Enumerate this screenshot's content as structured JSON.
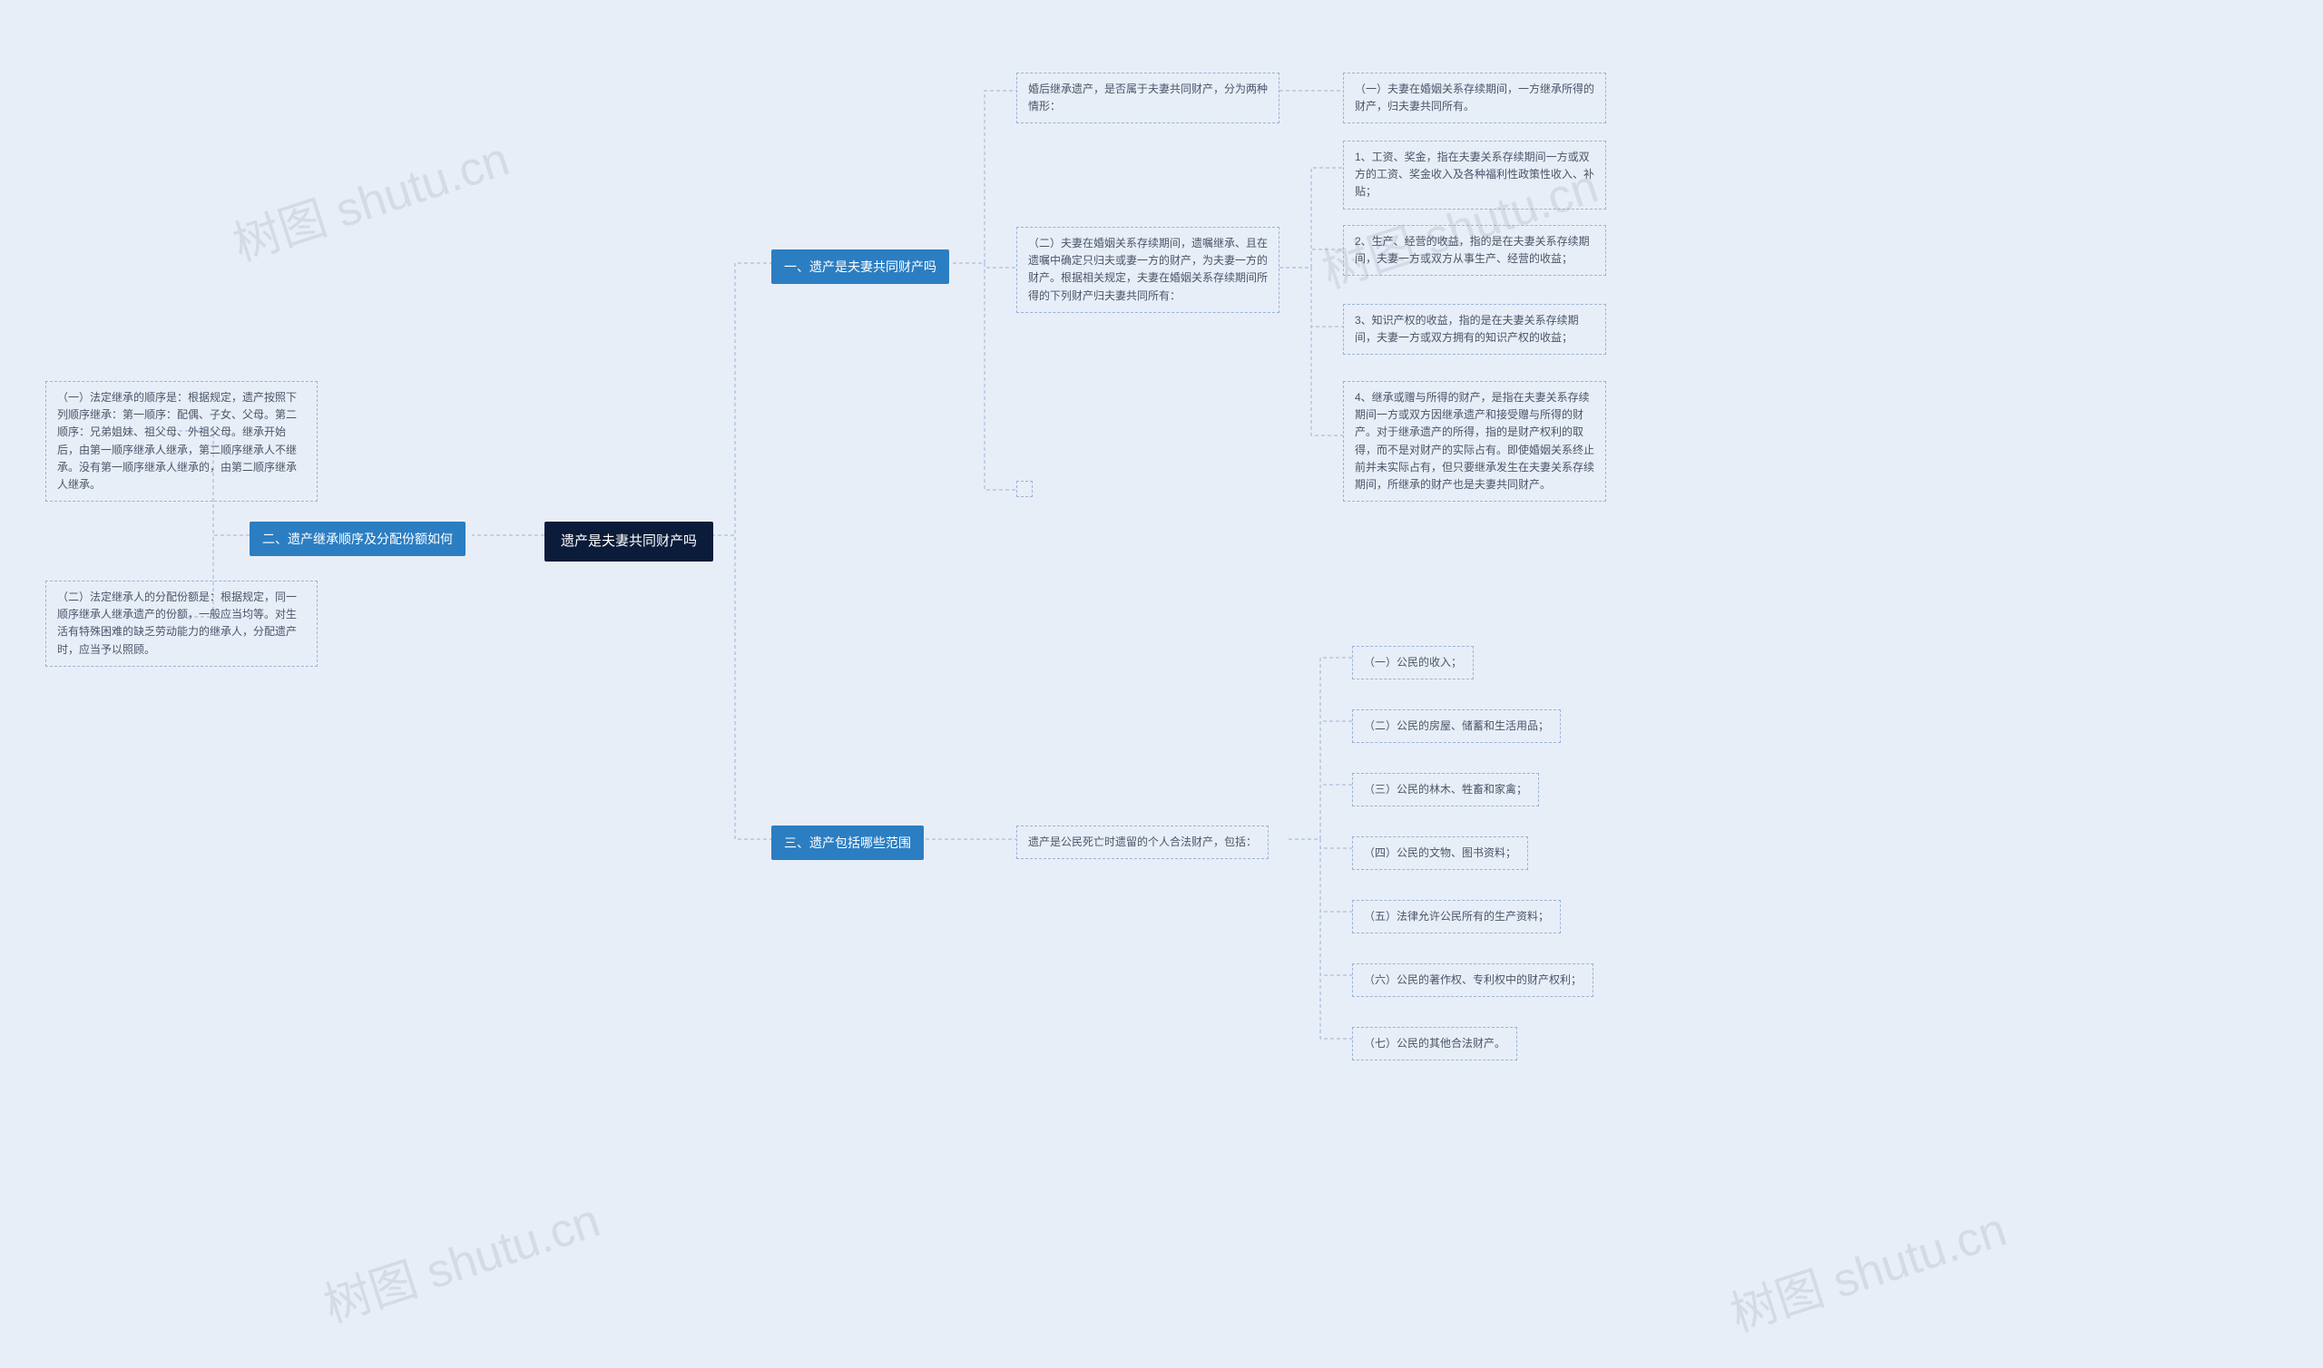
{
  "root": "遗产是夫妻共同财产吗",
  "branch1": {
    "label": "一、遗产是夫妻共同财产吗",
    "n1": "婚后继承遗产，是否属于夫妻共同财产，分为两种情形：",
    "n1a": "（一）夫妻在婚姻关系存续期间，一方继承所得的财产，归夫妻共同所有。",
    "n2": "（二）夫妻在婚姻关系存续期间，遗嘱继承、且在遗嘱中确定只归夫或妻一方的财产，为夫妻一方的财产。根据相关规定，夫妻在婚姻关系存续期间所得的下列财产归夫妻共同所有：",
    "n2a": "1、工资、奖金，指在夫妻关系存续期间一方或双方的工资、奖金收入及各种福利性政策性收入、补贴；",
    "n2b": "2、生产、经营的收益，指的是在夫妻关系存续期间，夫妻一方或双方从事生产、经营的收益；",
    "n2c": "3、知识产权的收益，指的是在夫妻关系存续期间，夫妻一方或双方拥有的知识产权的收益；",
    "n2d": "4、继承或赠与所得的财产，是指在夫妻关系存续期间一方或双方因继承遗产和接受赠与所得的财产。对于继承遗产的所得，指的是财产权利的取得，而不是对财产的实际占有。即使婚姻关系终止前并未实际占有，但只要继承发生在夫妻关系存续期间，所继承的财产也是夫妻共同财产。"
  },
  "branch2": {
    "label": "二、遗产继承顺序及分配份额如何",
    "n1": "（一）法定继承的顺序是：根据规定，遗产按照下列顺序继承：第一顺序：配偶、子女、父母。第二顺序：兄弟姐妹、祖父母、外祖父母。继承开始后，由第一顺序继承人继承，第二顺序继承人不继承。没有第一顺序继承人继承的，由第二顺序继承人继承。",
    "n2": "（二）法定继承人的分配份额是：根据规定，同一顺序继承人继承遗产的份额，一般应当均等。对生活有特殊困难的缺乏劳动能力的继承人，分配遗产时，应当予以照顾。"
  },
  "branch3": {
    "label": "三、遗产包括哪些范围",
    "n1": "遗产是公民死亡时遗留的个人合法财产，包括：",
    "items": [
      "（一）公民的收入；",
      "（二）公民的房屋、储蓄和生活用品；",
      "（三）公民的林木、牲畜和家禽；",
      "（四）公民的文物、图书资料；",
      "（五）法律允许公民所有的生产资料；",
      "（六）公民的著作权、专利权中的财产权利；",
      "（七）公民的其他合法财产。"
    ]
  },
  "watermark": "树图 shutu.cn"
}
